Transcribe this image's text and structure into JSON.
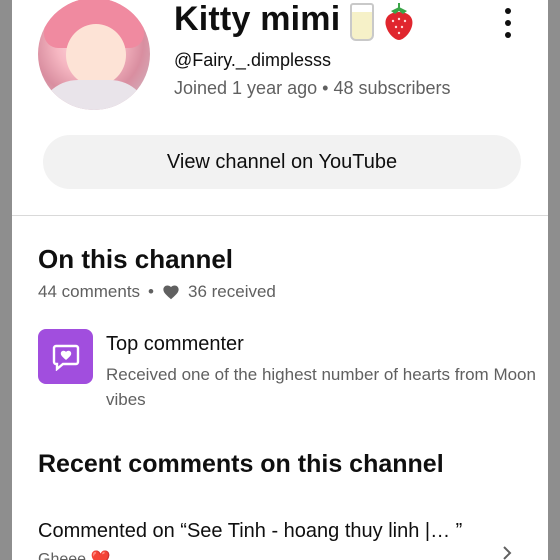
{
  "channel": {
    "name": "Kitty mimi",
    "name_emojis": [
      "milk-glass-icon",
      "strawberry-icon"
    ],
    "handle": "@Fairy._.dimplesss",
    "joined": "Joined 1 year ago",
    "separator": "•",
    "subscribers": "48 subscribers"
  },
  "actions": {
    "view_channel_label": "View channel on YouTube",
    "more_icon": "more-vert-icon"
  },
  "on_channel": {
    "title": "On this channel",
    "comments": "44 comments",
    "separator": "•",
    "received": "36 received",
    "heart_icon": "heart-icon"
  },
  "badge": {
    "title": "Top commenter",
    "description": "Received one of the highest number of hearts from Moon vibes",
    "icon": "heart-chat-icon",
    "color": "#a14ede"
  },
  "recent": {
    "title": "Recent comments on this channel",
    "commented_on": "Commented on “See Tinh - hoang thuy linh |… ”",
    "snippet": "Gheee ❤️"
  },
  "colors": {
    "background": "#ffffff",
    "secondary_text": "#606060",
    "button_bg": "#f2f2f2"
  }
}
